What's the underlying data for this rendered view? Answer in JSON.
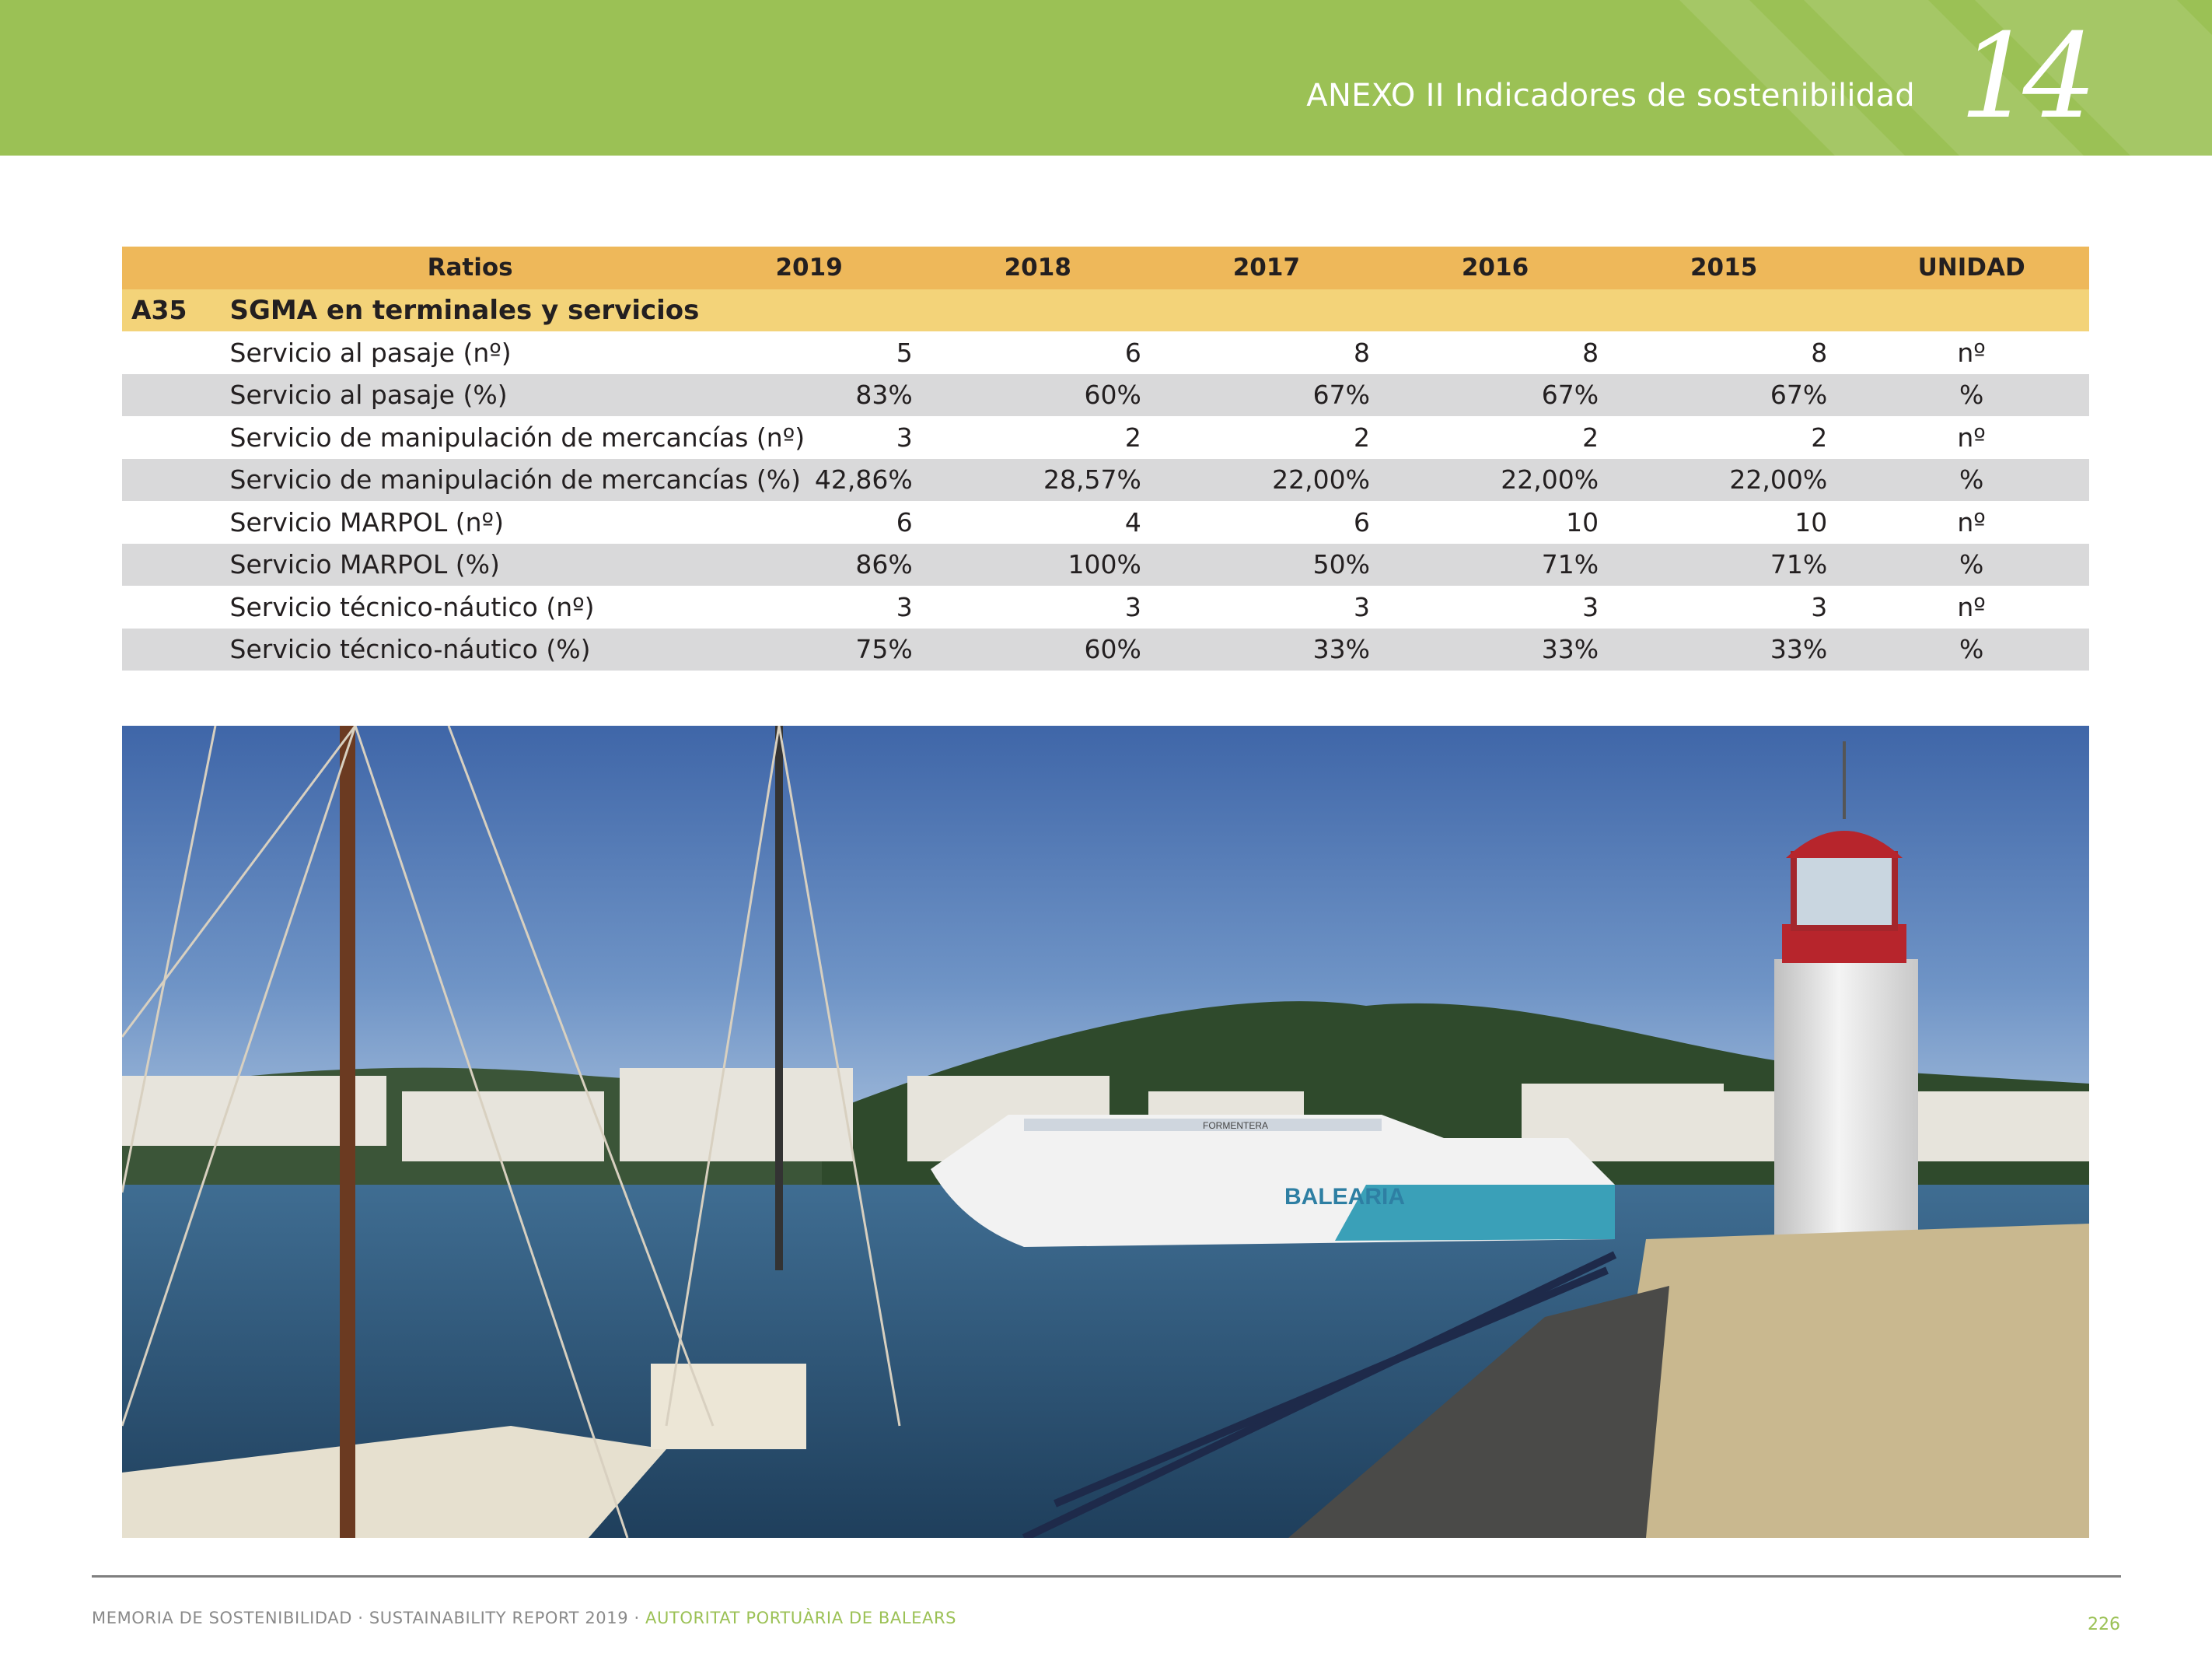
{
  "header": {
    "title": "ANEXO II Indicadores de sostenibilidad",
    "chapter_number": "14",
    "band_color": "#9bc155"
  },
  "table": {
    "columns": [
      "Ratios",
      "2019",
      "2018",
      "2017",
      "2016",
      "2015",
      "UNIDAD"
    ],
    "section": {
      "code": "A35",
      "title": "SGMA en terminales y servicios"
    },
    "rows": [
      {
        "name": "Servicio al pasaje (nº)",
        "values": [
          "5",
          "6",
          "8",
          "8",
          "8"
        ],
        "unit": "nº"
      },
      {
        "name": "Servicio al pasaje (%)",
        "values": [
          "83%",
          "60%",
          "67%",
          "67%",
          "67%"
        ],
        "unit": "%"
      },
      {
        "name": "Servicio de manipulación de mercancías (nº)",
        "values": [
          "3",
          "2",
          "2",
          "2",
          "2"
        ],
        "unit": "nº"
      },
      {
        "name": "Servicio de manipulación de mercancías (%)",
        "values": [
          "42,86%",
          "28,57%",
          "22,00%",
          "22,00%",
          "22,00%"
        ],
        "unit": "%"
      },
      {
        "name": "Servicio MARPOL (nº)",
        "values": [
          "6",
          "4",
          "6",
          "10",
          "10"
        ],
        "unit": "nº"
      },
      {
        "name": "Servicio MARPOL (%)",
        "values": [
          "86%",
          "100%",
          "50%",
          "71%",
          "71%"
        ],
        "unit": "%"
      },
      {
        "name": "Servicio técnico-náutico (nº)",
        "values": [
          "3",
          "3",
          "3",
          "3",
          "3"
        ],
        "unit": "nº"
      },
      {
        "name": "Servicio técnico-náutico (%)",
        "values": [
          "75%",
          "60%",
          "33%",
          "33%",
          "33%"
        ],
        "unit": "%"
      }
    ],
    "colors": {
      "header": "#eeb85a",
      "section": "#f3d379",
      "stripe": "#d9d9da"
    }
  },
  "photo": {
    "ferry_name": "BALEARIA",
    "ferry_side_text": "FORMENTERA"
  },
  "footer": {
    "part1": "MEMORIA DE SOSTENIBILIDAD · SUSTAINABILITY REPORT 2019 · ",
    "part2": "AUTORITAT PORTUÀRIA DE BALEARS",
    "page_number": "226"
  }
}
